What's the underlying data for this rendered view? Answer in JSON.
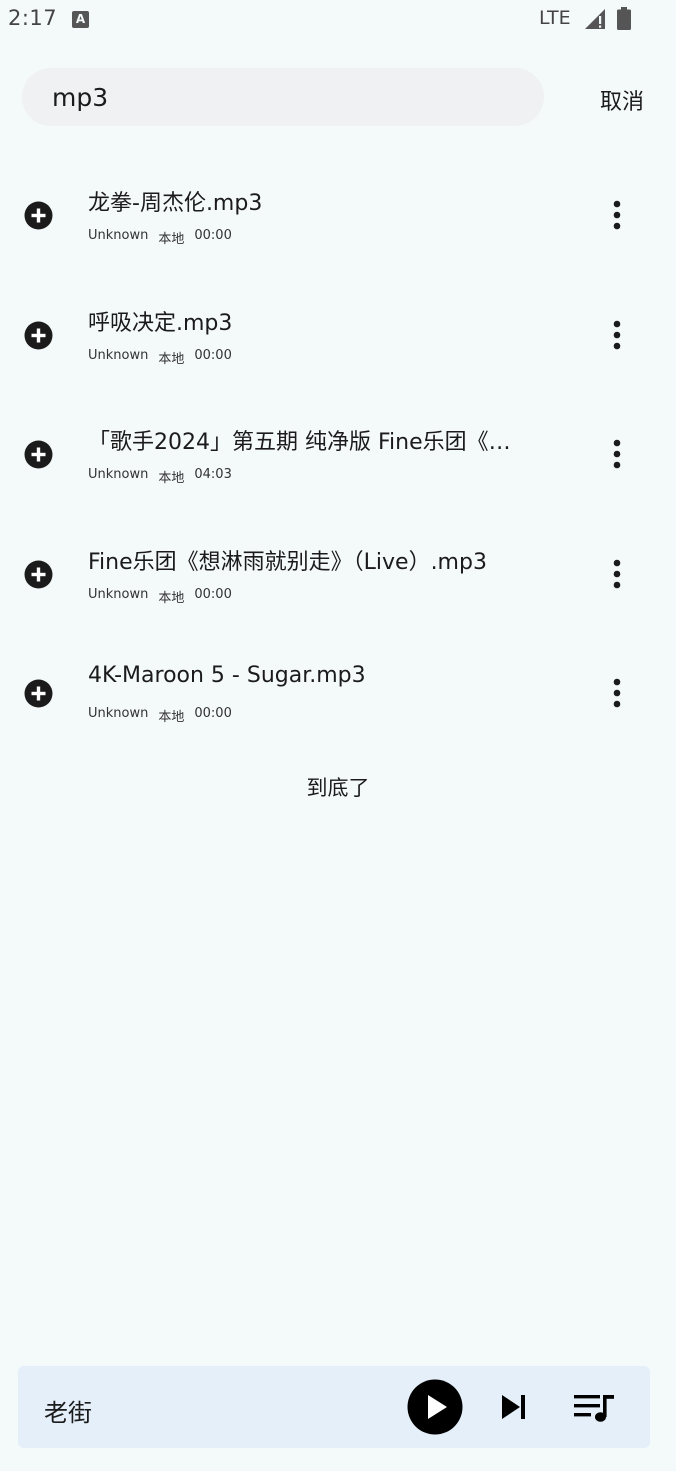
{
  "status_bar": {
    "time": "2:17",
    "notification_letter": "A",
    "network": "LTE"
  },
  "search": {
    "value": "mp3",
    "cancel_label": "取消"
  },
  "songs": [
    {
      "title": "龙拳-周杰伦.mp3",
      "artist": "Unknown",
      "source": "本地",
      "duration": "00:00"
    },
    {
      "title": "呼吸决定.mp3",
      "artist": "Unknown",
      "source": "本地",
      "duration": "00:00"
    },
    {
      "title": "「歌手2024」第五期 纯净版 Fine乐团《…",
      "artist": "Unknown",
      "source": "本地",
      "duration": "04:03"
    },
    {
      "title": "Fine乐团《想淋雨就别走》（Live）.mp3",
      "artist": "Unknown",
      "source": "本地",
      "duration": "00:00"
    },
    {
      "title": "4K-Maroon 5 - Sugar.mp3",
      "artist": "Unknown",
      "source": "本地",
      "duration": "00:00"
    }
  ],
  "list_end_label": "到底了",
  "player": {
    "current_title": "老街"
  },
  "icons": {
    "add": "plus-circle-icon",
    "more": "more-vertical-icon",
    "play": "play-icon",
    "next": "skip-next-icon",
    "queue": "playlist-icon"
  }
}
